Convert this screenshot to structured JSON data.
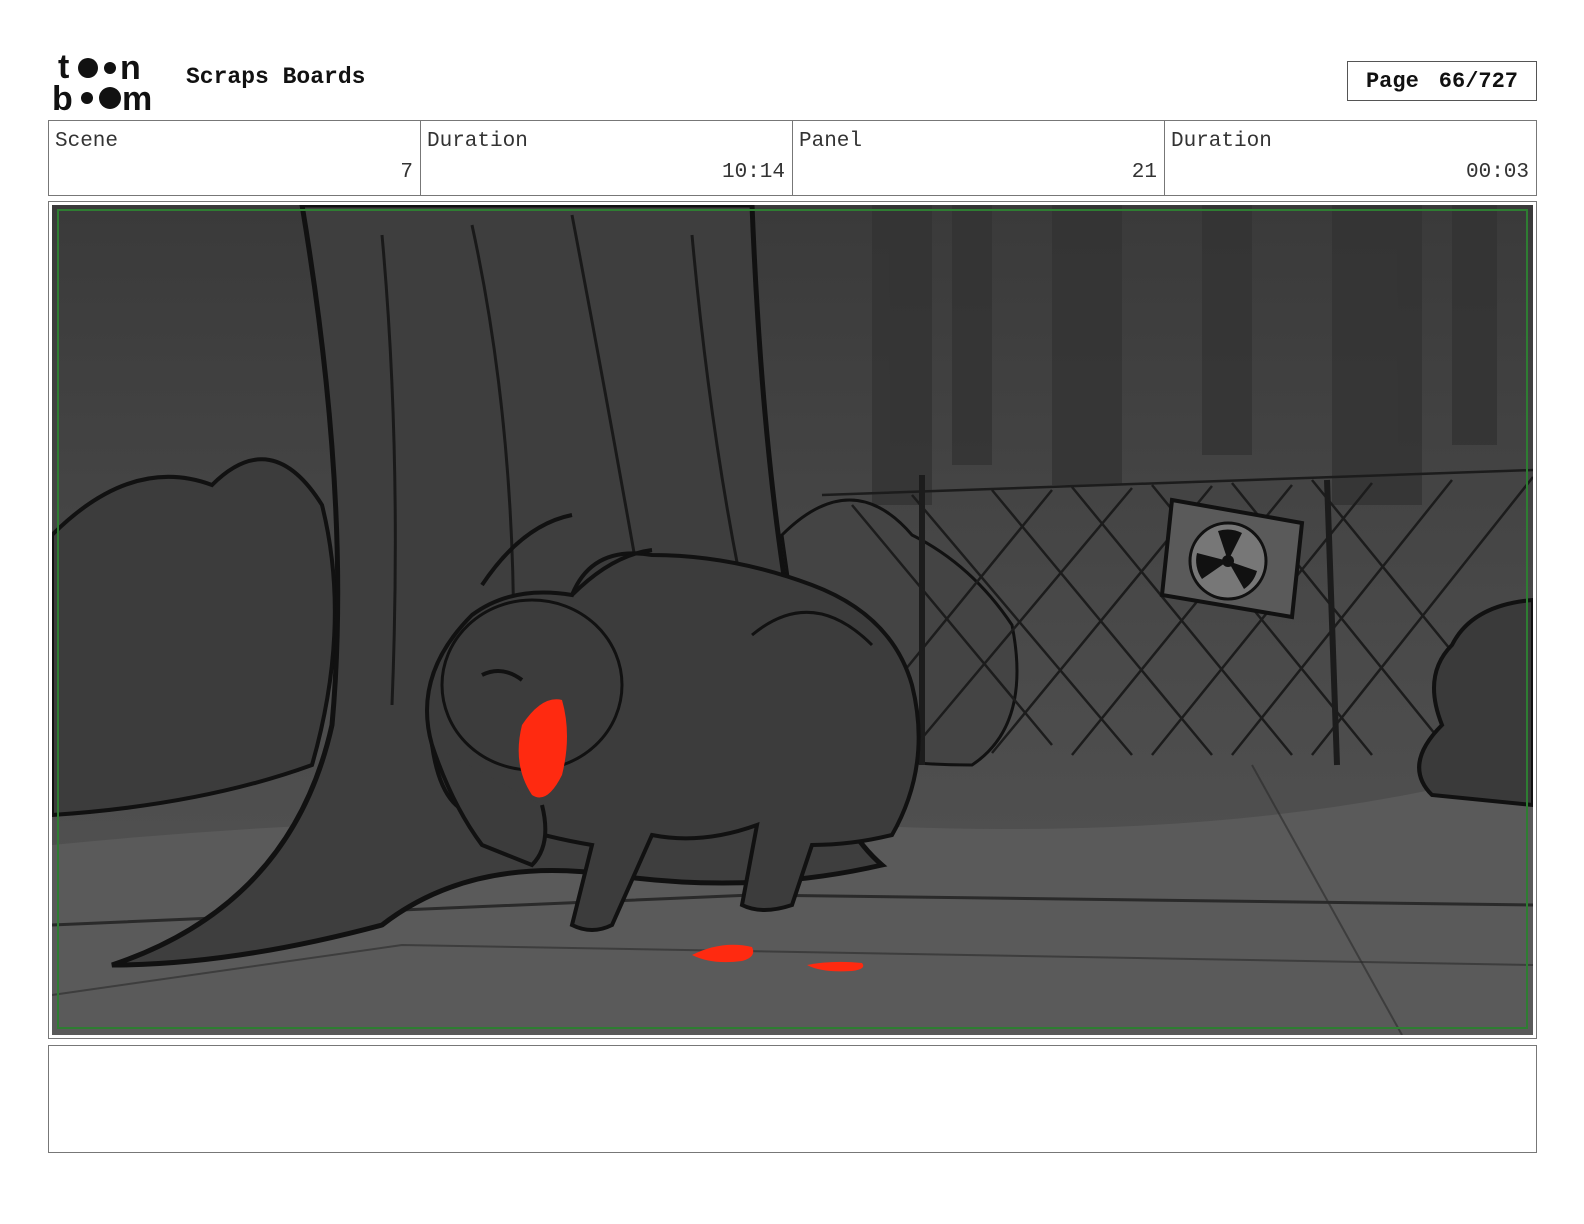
{
  "header": {
    "brand": "toon boom",
    "title": "Scraps Boards",
    "page_label": "Page",
    "page_value": "66/727"
  },
  "info": [
    {
      "label": "Scene",
      "value": "7"
    },
    {
      "label": "Duration",
      "value": "10:14"
    },
    {
      "label": "Panel",
      "value": "21"
    },
    {
      "label": "Duration",
      "value": "00:03"
    }
  ],
  "panel": {
    "colors": {
      "background": "#4a4a4a",
      "ground": "#5a5a5a",
      "creature": "#3c3c3c",
      "blood": "#ff2a10",
      "safe_frame": "#2e7d32"
    },
    "icons": [
      "radiation-sign-icon"
    ]
  },
  "notes": {
    "text": ""
  }
}
